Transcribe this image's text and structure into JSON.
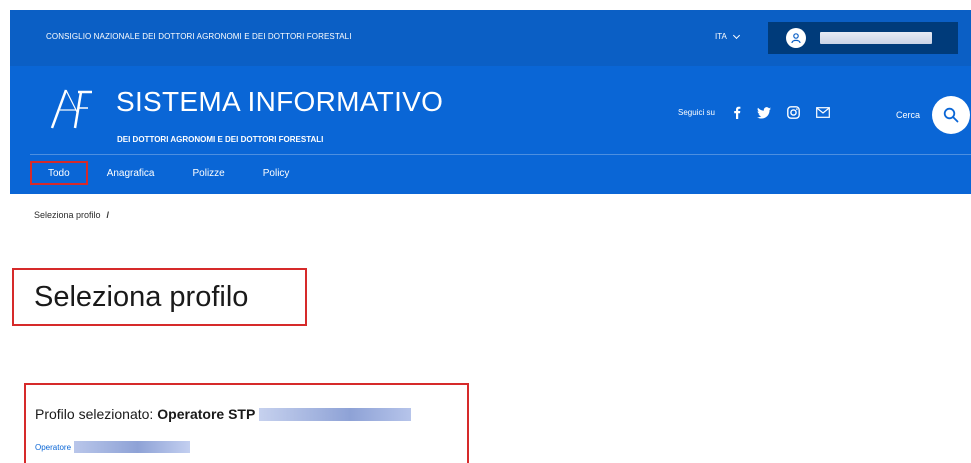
{
  "topbar": {
    "org_name": "CONSIGLIO NAZIONALE DEI DOTTORI AGRONOMI E DEI DOTTORI FORESTALI",
    "language": "ITA",
    "colors": {
      "background": "#0b5fc5",
      "user_box": "#003b7a"
    }
  },
  "header": {
    "title": "SISTEMA INFORMATIVO",
    "subtitle": "DEI DOTTORI AGRONOMI E DEI DOTTORI FORESTALI",
    "follow_label": "Seguici su",
    "social_icons": [
      "facebook-icon",
      "twitter-icon",
      "instagram-icon",
      "mail-icon"
    ],
    "search_label": "Cerca",
    "colors": {
      "background": "#0a66d6"
    }
  },
  "nav": {
    "items": [
      {
        "label": "Todo"
      },
      {
        "label": "Anagrafica"
      },
      {
        "label": "Polizze"
      },
      {
        "label": "Policy"
      }
    ]
  },
  "breadcrumb": {
    "current": "Seleziona profilo",
    "separator": "/"
  },
  "main": {
    "page_title": "Seleziona profilo",
    "profile_label": "Profilo selezionato:",
    "profile_value": "Operatore STP",
    "operator_link": "Operatore"
  },
  "highlight_color": "#d62a2a"
}
